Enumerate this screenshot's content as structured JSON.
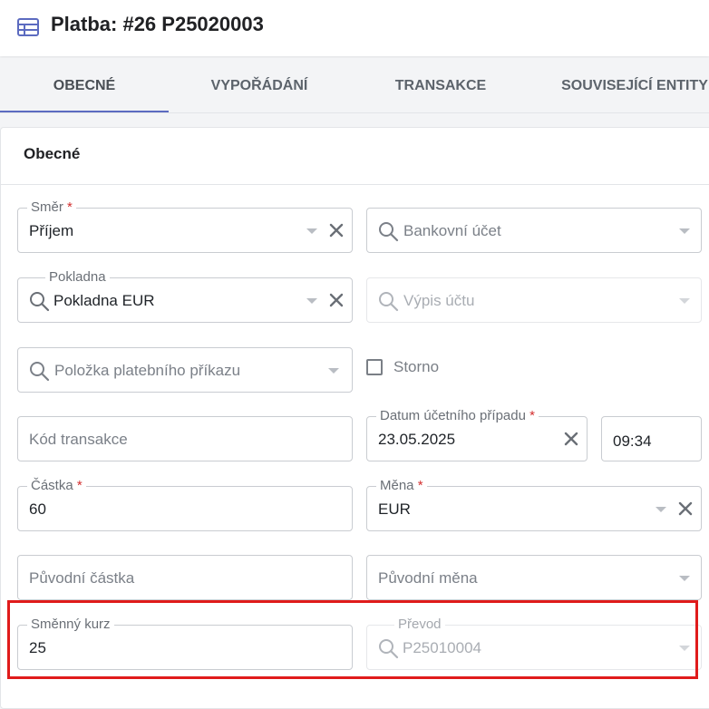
{
  "header": {
    "title": "Platba: #26 P25020003",
    "icon": "table-icon"
  },
  "tabs": [
    {
      "label": "OBECNÉ",
      "active": true
    },
    {
      "label": "VYPOŘÁDÁNÍ",
      "active": false
    },
    {
      "label": "TRANSAKCE",
      "active": false
    },
    {
      "label": "SOUVISEJÍCÍ ENTITY",
      "active": false
    }
  ],
  "section": {
    "title": "Obecné"
  },
  "form": {
    "smer": {
      "label": "Směr",
      "required": "*",
      "value": "Příjem"
    },
    "bankovni_ucet": {
      "placeholder": "Bankovní účet"
    },
    "pokladna": {
      "label": "Pokladna",
      "value": "Pokladna EUR"
    },
    "vypis_uctu": {
      "placeholder": "Výpis účtu"
    },
    "polozka": {
      "placeholder": "Položka platebního příkazu"
    },
    "storno": {
      "label": "Storno",
      "checked": false
    },
    "kod_transakce": {
      "placeholder": "Kód transakce"
    },
    "datum": {
      "label": "Datum účetního případu",
      "required": "*",
      "value": "23.05.2025"
    },
    "cas": {
      "value": "09:34"
    },
    "castka": {
      "label": "Částka",
      "required": "*",
      "value": "60"
    },
    "mena": {
      "label": "Měna",
      "required": "*",
      "value": "EUR"
    },
    "puvodni_castka": {
      "placeholder": "Původní částka"
    },
    "puvodni_mena": {
      "placeholder": "Původní měna"
    },
    "smenny_kurz": {
      "label": "Směnný kurz",
      "value": "25"
    },
    "prevod": {
      "label": "Převod",
      "value": "P25010004"
    }
  },
  "colors": {
    "accent": "#5c6bc0",
    "required": "#d32f2f",
    "highlight": "#e01b1b"
  }
}
